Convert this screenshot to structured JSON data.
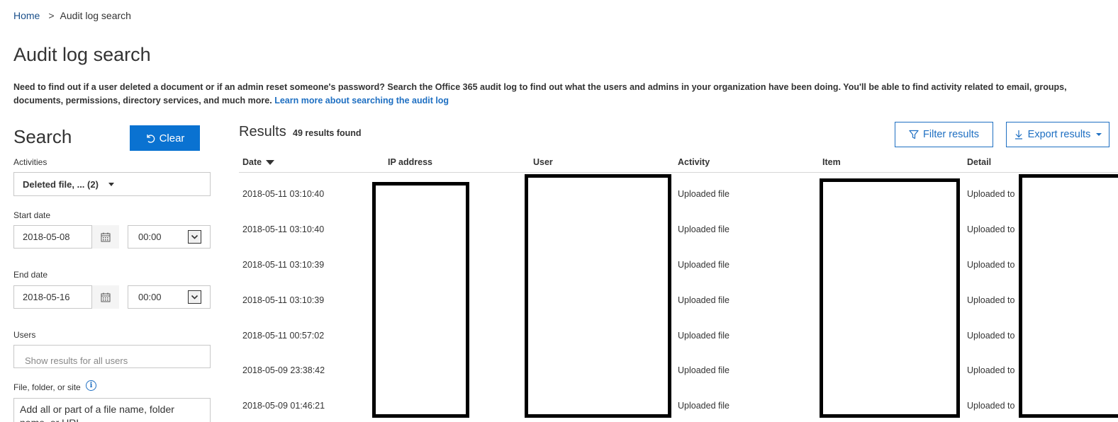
{
  "breadcrumb": {
    "home": "Home",
    "separator": ">",
    "current": "Audit log search"
  },
  "page": {
    "title": "Audit log search",
    "description": "Need to find out if a user deleted a document or if an admin reset someone's password? Search the Office 365 audit log to find out what the users and admins in your organization have been doing. You'll be able to find activity related to email, groups, documents, permissions, directory services, and much more.",
    "learn_more": "Learn more about searching the audit log"
  },
  "search": {
    "title": "Search",
    "clear_label": "Clear",
    "activities_label": "Activities",
    "activities_value": "Deleted file, ... (2)",
    "start_date_label": "Start date",
    "start_date": "2018-05-08",
    "start_time": "00:00",
    "end_date_label": "End date",
    "end_date": "2018-05-16",
    "end_time": "00:00",
    "users_label": "Users",
    "users_placeholder": "Show results for all users",
    "file_label": "File, folder, or site",
    "file_placeholder": "Add all or part of a file name, folder name, or URL."
  },
  "results": {
    "title": "Results",
    "count": "49 results found",
    "filter_label": "Filter results",
    "export_label": "Export results",
    "columns": [
      "Date",
      "IP address",
      "User",
      "Activity",
      "Item",
      "Detail"
    ],
    "rows": [
      {
        "date": "2018-05-11 03:10:40",
        "activity": "Uploaded file",
        "detail": "Uploaded to"
      },
      {
        "date": "2018-05-11 03:10:40",
        "activity": "Uploaded file",
        "detail": "Uploaded to"
      },
      {
        "date": "2018-05-11 03:10:39",
        "activity": "Uploaded file",
        "detail": "Uploaded to"
      },
      {
        "date": "2018-05-11 03:10:39",
        "activity": "Uploaded file",
        "detail": "Uploaded to"
      },
      {
        "date": "2018-05-11 00:57:02",
        "activity": "Uploaded file",
        "detail": "Uploaded to"
      },
      {
        "date": "2018-05-09 23:38:42",
        "activity": "Uploaded file",
        "detail": "Uploaded to"
      },
      {
        "date": "2018-05-09 01:46:21",
        "activity": "Uploaded file",
        "detail": "Uploaded to"
      }
    ]
  },
  "colors": {
    "accent": "#0a72d1",
    "link": "#1e6fc2",
    "text": "#333333"
  }
}
